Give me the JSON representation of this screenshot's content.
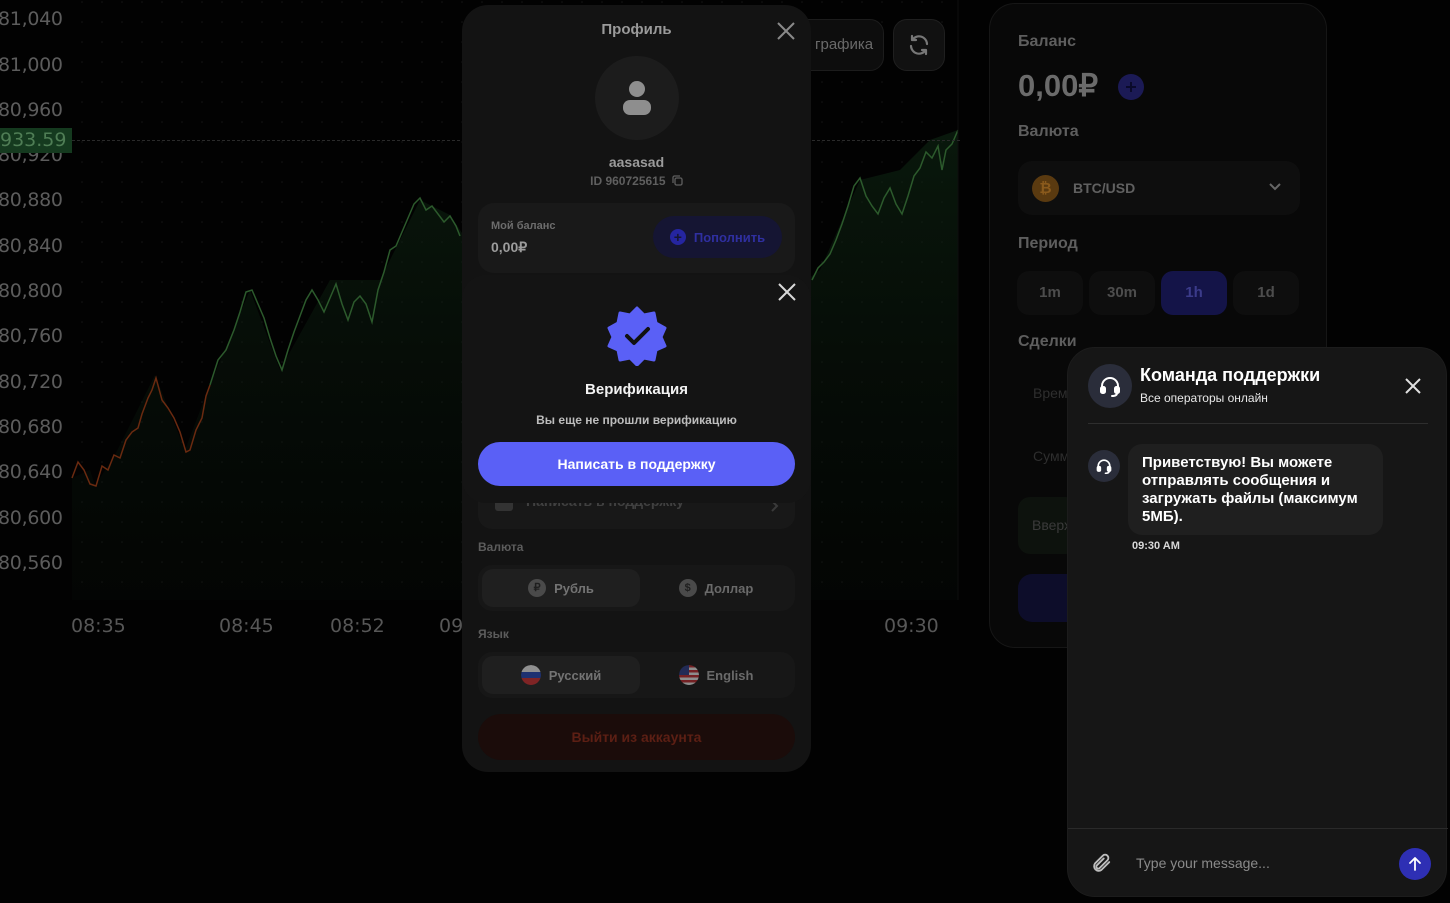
{
  "chart": {
    "price_tag": "933.59",
    "y_ticks": [
      "81,040",
      "81,000",
      "80,960",
      "80,920",
      "80,880",
      "80,840",
      "80,800",
      "80,760",
      "80,720",
      "80,680",
      "80,640",
      "80,600",
      "80,560"
    ],
    "x_ticks": [
      "08:35",
      "08:45",
      "08:52",
      "09",
      "09:30"
    ]
  },
  "toolbar": {
    "chart_type_label": "графика",
    "refresh_icon": "refresh-icon"
  },
  "trade_panel": {
    "balance_label": "Баланс",
    "balance_value": "0,00₽",
    "currency_label": "Валюта",
    "currency_value": "BTC/USD",
    "period_label": "Период",
    "periods": [
      "1m",
      "30m",
      "1h",
      "1d"
    ],
    "active_period": "1h",
    "deals_label": "Сделки",
    "time_label": "Врем",
    "sum_label": "Сумм",
    "up_label": "Вверх"
  },
  "profile": {
    "title": "Профиль",
    "username": "aasasad",
    "user_id": "ID 960725615",
    "balance_label": "Мой баланс",
    "balance_value": "0,00₽",
    "topup_label": "Пополнить",
    "support_label": "Написать в поддержку",
    "currency_section": "Валюта",
    "currencies": [
      {
        "symbol": "₽",
        "label": "Рубль"
      },
      {
        "symbol": "$",
        "label": "Доллар"
      }
    ],
    "language_section": "Язык",
    "languages": [
      {
        "label": "Русский"
      },
      {
        "label": "English"
      }
    ],
    "logout_label": "Выйти из аккаунта"
  },
  "verification": {
    "title": "Верификация",
    "subtitle": "Вы еще не прошли верификацию",
    "button_label": "Написать в поддержку",
    "accent_color": "#5a60f6"
  },
  "support_chat": {
    "title": "Команда поддержки",
    "status": "Все операторы онлайн",
    "message": "Приветствую! Вы можете отправлять сообщения и загружать файлы (максимум 5МБ).",
    "message_time": "09:30 AM",
    "input_placeholder": "Type your message...",
    "send_color": "#2e2fb4"
  }
}
